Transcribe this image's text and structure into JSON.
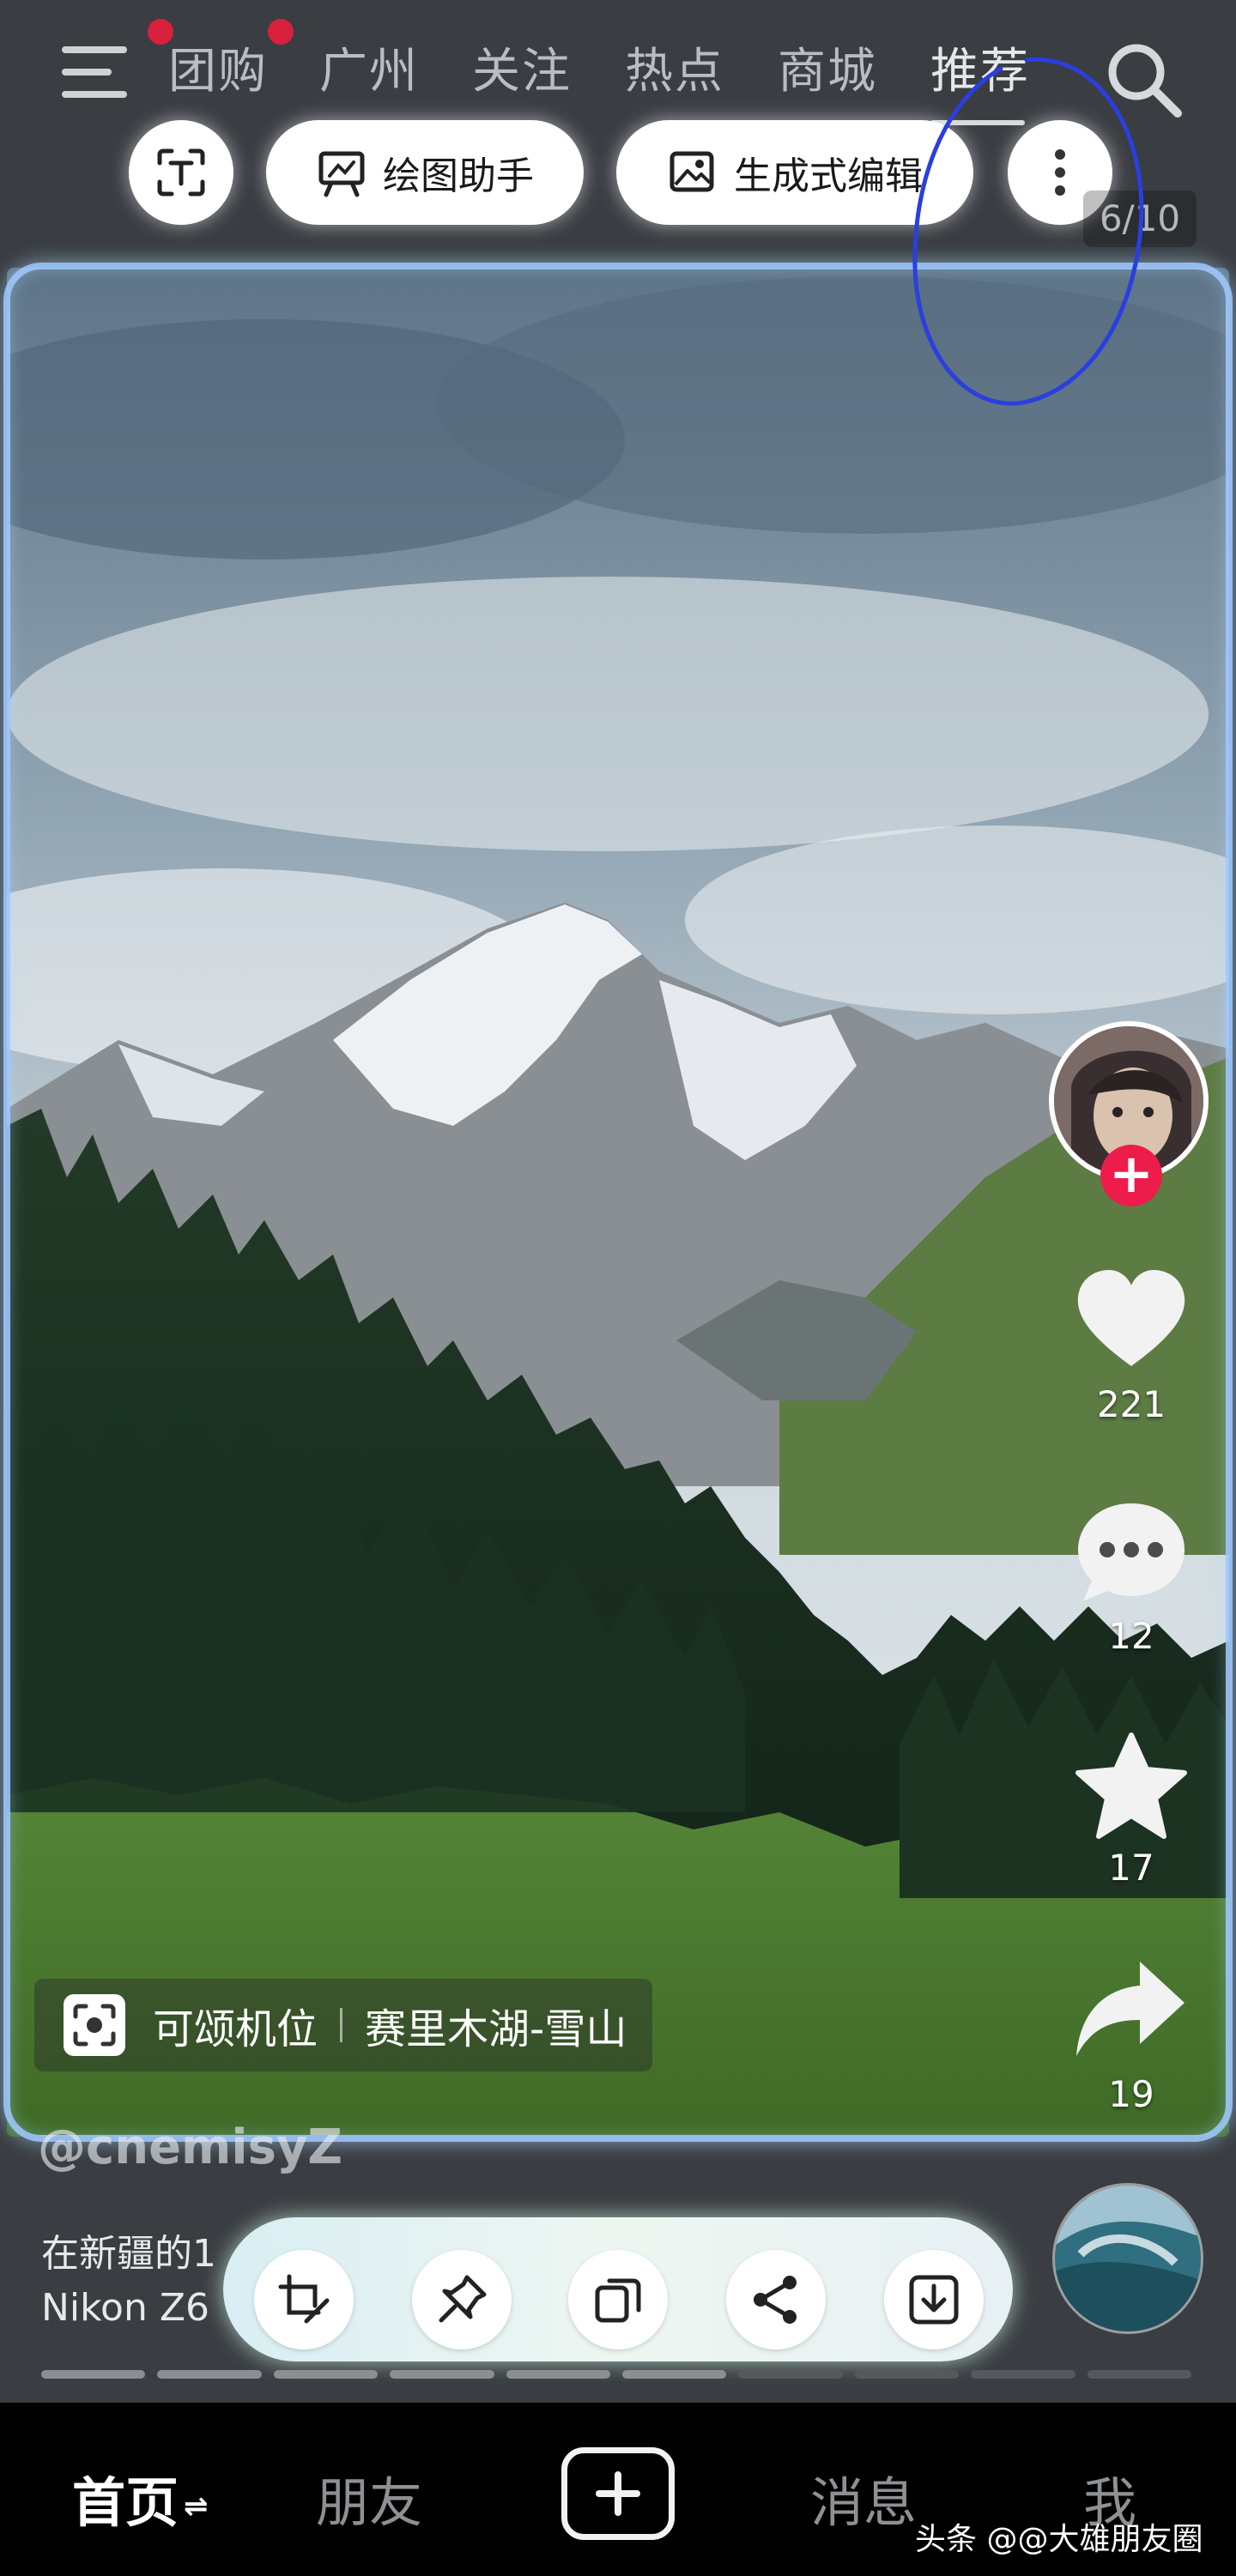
{
  "top_nav": {
    "tabs": [
      {
        "label": "团购"
      },
      {
        "label": "广州"
      },
      {
        "label": "关注"
      },
      {
        "label": "热点"
      },
      {
        "label": "商城"
      },
      {
        "label": "推荐"
      }
    ],
    "active_tab": "推荐"
  },
  "ai_toolbar": {
    "drawing_assistant_label": "绘图助手",
    "generative_edit_label": "生成式编辑"
  },
  "image_counter": "6/10",
  "right_rail": {
    "likes": "221",
    "comments": "12",
    "favorites": "17",
    "shares": "19"
  },
  "location": {
    "label": "可颂机位",
    "place": "赛里木湖-雪山"
  },
  "post": {
    "author": "@cnemisyZ",
    "caption_line1": "在新疆的1",
    "caption_line2": "Nikon Z6"
  },
  "progress": {
    "total": 10,
    "current": 6
  },
  "bottom_nav": {
    "home": "首页",
    "friends": "朋友",
    "messages": "消息",
    "me": "我"
  },
  "watermark": "头条 @@大雄朋友圈",
  "colors": {
    "accent_red": "#ee1c4a",
    "annotation_blue": "#2a3fe0",
    "notification_dot": "#d8203d"
  }
}
